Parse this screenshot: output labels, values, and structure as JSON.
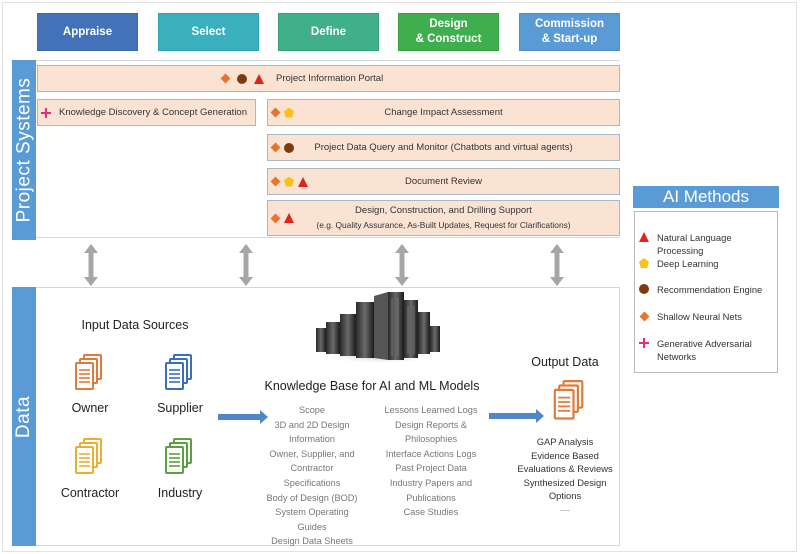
{
  "phases": [
    {
      "label": "Appraise",
      "color": "#4472b8"
    },
    {
      "label": "Select",
      "color": "#3ab0bf"
    },
    {
      "label": "Define",
      "color": "#3fb08a"
    },
    {
      "label": "Design\n& Construct",
      "color": "#3fae4f"
    },
    {
      "label": "Commission\n& Start-up",
      "color": "#5b9bd5"
    }
  ],
  "sections": {
    "project_systems": "Project Systems",
    "data": "Data"
  },
  "project_systems": {
    "bars": [
      {
        "label": "Project Information Portal",
        "methods": [
          "shallow-neural-nets",
          "recommendation-engine",
          "natural-language-processing"
        ]
      },
      {
        "label": "Knowledge Discovery & Concept Generation",
        "methods": [
          "generative-adversarial-networks"
        ]
      },
      {
        "label": "Change Impact Assessment",
        "methods": [
          "shallow-neural-nets",
          "deep-learning"
        ]
      },
      {
        "label": "Project Data Query and Monitor (Chatbots and virtual agents)",
        "methods": [
          "shallow-neural-nets",
          "recommendation-engine"
        ]
      },
      {
        "label": "Document Review",
        "methods": [
          "shallow-neural-nets",
          "deep-learning",
          "natural-language-processing"
        ]
      },
      {
        "label": "Design, Construction, and Drilling Support",
        "sublabel": "(e.g. Quality Assurance, As-Built Updates, Request for Clarifications)",
        "methods": [
          "shallow-neural-nets",
          "natural-language-processing"
        ]
      }
    ]
  },
  "data_section": {
    "input_title": "Input Data Sources",
    "sources": [
      {
        "label": "Owner",
        "color": "#e07a3a"
      },
      {
        "label": "Supplier",
        "color": "#3a6fc0"
      },
      {
        "label": "Contractor",
        "color": "#e8b030"
      },
      {
        "label": "Industry",
        "color": "#5aa040"
      }
    ],
    "kb_title": "Knowledge Base for AI and ML Models",
    "kb_left": [
      "Scope",
      "3D and 2D Design",
      "Information",
      "Owner, Supplier, and",
      "Contractor Specifications",
      "Body of Design (BOD)",
      "System Operating Guides",
      "Design Data Sheets"
    ],
    "kb_right": [
      "Lessons Learned Logs",
      "Design Reports &",
      "Philosophies",
      "Interface Actions Logs",
      "Past Project Data",
      "Industry Papers and",
      "Publications",
      "Case Studies"
    ],
    "output_title": "Output Data",
    "output_color": "#e07a3a",
    "outputs": [
      "GAP Analysis",
      "Evidence Based",
      "Evaluations & Reviews",
      "Synthesized Design",
      "Options",
      "....."
    ]
  },
  "ai_methods": {
    "title": "AI Methods",
    "items": [
      {
        "icon": "triangle",
        "label": "Natural Language Processing"
      },
      {
        "icon": "pentagon",
        "label": "Deep Learning"
      },
      {
        "icon": "circle",
        "label": "Recommendation Engine"
      },
      {
        "icon": "diamond",
        "label": "Shallow Neural Nets"
      },
      {
        "icon": "plus",
        "label": "Generative Adversarial\nNetworks"
      }
    ]
  }
}
